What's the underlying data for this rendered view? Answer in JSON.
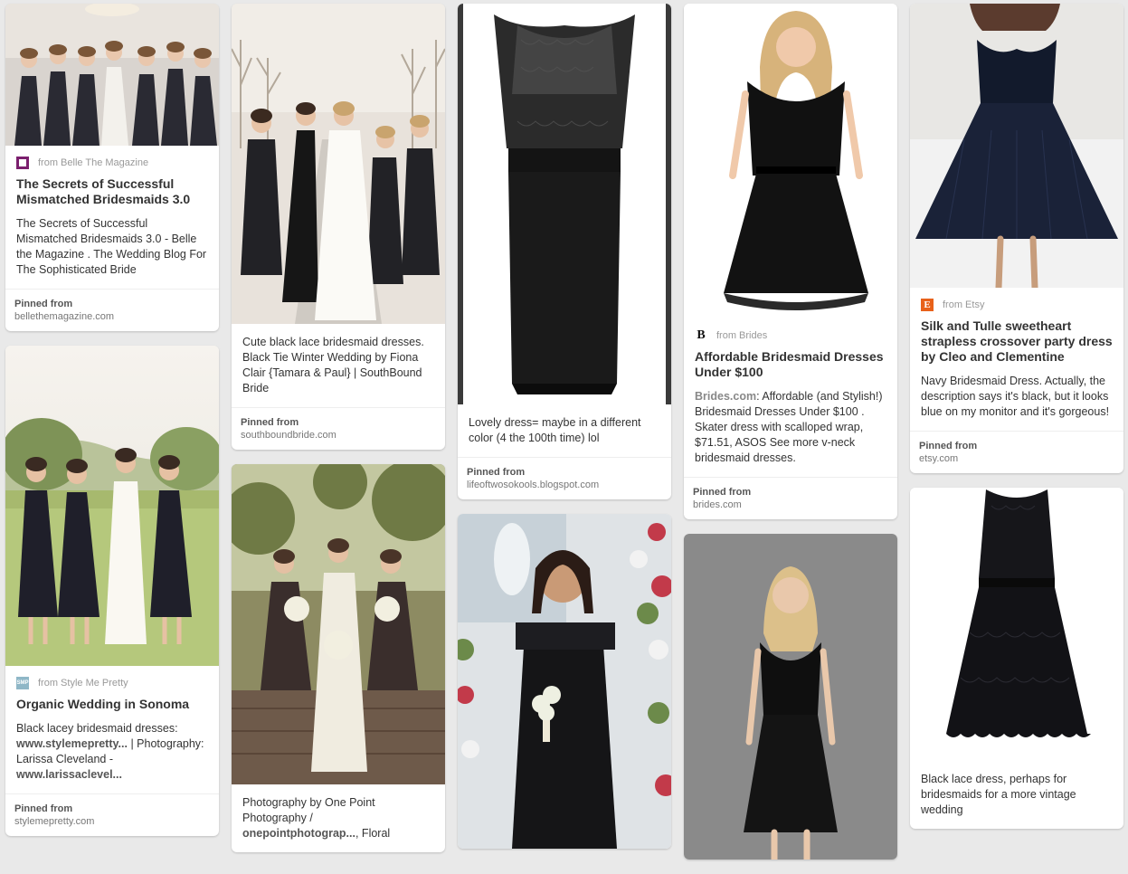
{
  "pins": {
    "c1p1": {
      "source": "from Belle The Magazine",
      "title": "The Secrets of Successful Mismatched Bridesmaids 3.0",
      "desc": "The Secrets of Successful Mismatched Bridesmaids 3.0 - Belle the Magazine . The Wedding Blog For The Sophisticated Bride",
      "pinned_label": "Pinned from",
      "pinned_domain": "bellethemagazine.com"
    },
    "c1p2": {
      "source": "from Style Me Pretty",
      "favicon_text": "SMP",
      "title": "Organic Wedding in Sonoma",
      "desc_prefix": "Black lacey bridesmaid dresses:",
      "desc_link1": "www.stylemepretty...",
      "desc_mid": " | Photography: Larissa Cleveland -",
      "desc_link2": "www.larissaclevel...",
      "pinned_label": "Pinned from",
      "pinned_domain": "stylemepretty.com"
    },
    "c2p1": {
      "desc": "Cute black lace bridesmaid dresses. Black Tie Winter Wedding by Fiona Clair {Tamara & Paul} | SouthBound Bride",
      "pinned_label": "Pinned from",
      "pinned_domain": "southboundbride.com"
    },
    "c2p2": {
      "desc_prefix": "Photography by One Point Photography /",
      "desc_link": "onepointphotograp...",
      "desc_suffix": ", Floral"
    },
    "c3p1": {
      "desc": "Lovely dress= maybe in a different color (4 the 100th time) lol",
      "pinned_label": "Pinned from",
      "pinned_domain": "lifeoftwosokools.blogspot.com"
    },
    "c4p1": {
      "source": "from Brides",
      "favicon_text": "B",
      "title": "Affordable Bridesmaid Dresses Under $100",
      "desc_link": "Brides.com",
      "desc": ": Affordable (and Stylish!) Bridesmaid Dresses Under $100 . Skater dress with scalloped wrap, $71.51, ASOS See more v-neck bridesmaid dresses.",
      "pinned_label": "Pinned from",
      "pinned_domain": "brides.com"
    },
    "c5p1": {
      "source": "from Etsy",
      "favicon_text": "E",
      "title": "Silk and Tulle sweetheart strapless crossover party dress by Cleo and Clementine",
      "desc": "Navy Bridesmaid Dress. Actually, the description says it's black, but it looks blue on my monitor and it's gorgeous!",
      "pinned_label": "Pinned from",
      "pinned_domain": "etsy.com"
    },
    "c5p2": {
      "desc": "Black lace dress, perhaps for bridesmaids for a more vintage wedding"
    }
  },
  "colors": {
    "belle_favicon": "#7b1f6e",
    "smp_favicon": "#8fb7c7",
    "etsy_favicon": "#e8611a",
    "background": "#e9e9e9"
  }
}
